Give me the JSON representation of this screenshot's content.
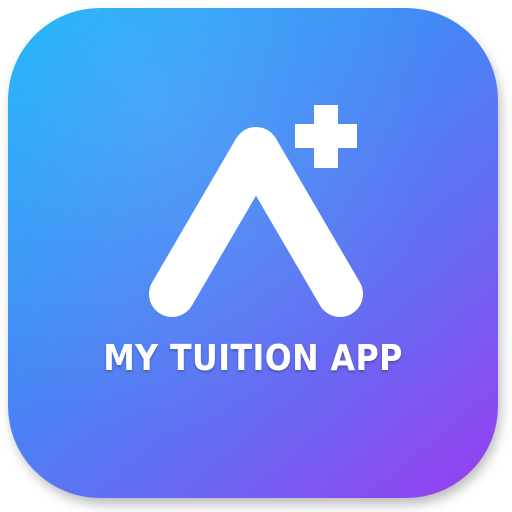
{
  "app": {
    "title": "MY TUITION APP",
    "icon_name": "a-plus-logo-icon"
  },
  "colors": {
    "gradient_start": "#16b4fa",
    "gradient_mid": "#3f8cf5",
    "gradient_end": "#9a3cf0",
    "mark": "#ffffff"
  }
}
